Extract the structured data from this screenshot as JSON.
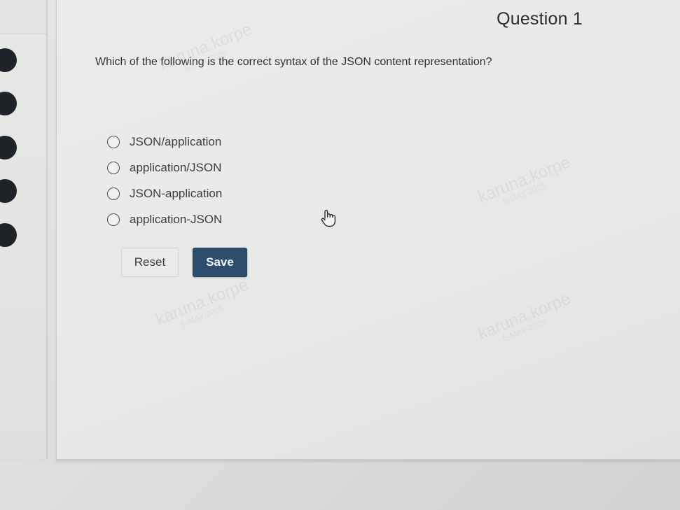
{
  "question": {
    "title": "Question 1",
    "text": "Which of the following is the correct syntax of the JSON content representation?",
    "options": [
      {
        "label": "JSON/application",
        "selected": false
      },
      {
        "label": "application/JSON",
        "selected": false
      },
      {
        "label": "JSON-application",
        "selected": false
      },
      {
        "label": "application-JSON",
        "selected": false
      }
    ]
  },
  "buttons": {
    "reset_label": "Reset",
    "save_label": "Save"
  },
  "watermark": {
    "name": "karuna.korpe",
    "date": "5-MAY-2025"
  },
  "colors": {
    "save_button": "#2d4d6e",
    "nav_circle": "#1e2328"
  }
}
